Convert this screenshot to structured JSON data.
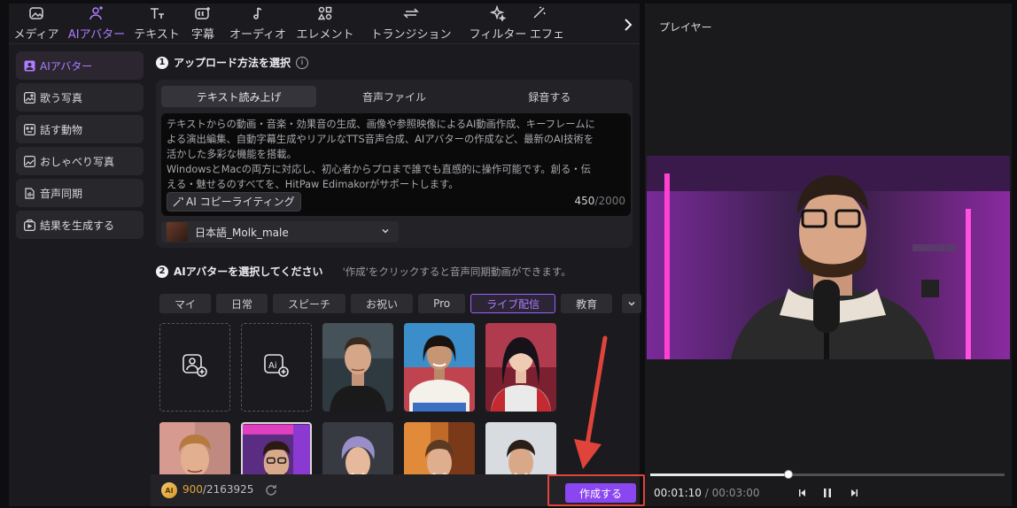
{
  "toolbar": {
    "items": [
      {
        "label": "メディア",
        "icon": "media-icon"
      },
      {
        "label": "AIアバター",
        "icon": "ai-avatar-icon",
        "active": true
      },
      {
        "label": "テキスト",
        "icon": "text-icon"
      },
      {
        "label": "字幕",
        "icon": "subtitle-icon"
      },
      {
        "label": "オーディオ",
        "icon": "audio-icon"
      },
      {
        "label": "エレメント",
        "icon": "element-icon"
      },
      {
        "label": "トランジション",
        "icon": "transition-icon"
      },
      {
        "label": "フィルター",
        "icon": "filter-icon"
      },
      {
        "label": "エフェ",
        "icon": "effect-icon"
      }
    ]
  },
  "sidebar": {
    "items": [
      {
        "label": "AIアバター",
        "active": true
      },
      {
        "label": "歌う写真"
      },
      {
        "label": "話す動物"
      },
      {
        "label": "おしゃべり写真"
      },
      {
        "label": "音声同期"
      },
      {
        "label": "結果を生成する"
      }
    ]
  },
  "step1": {
    "num": "1",
    "title": "アップロード方法を選択",
    "tabs": [
      "テキスト読み上げ",
      "音声ファイル",
      "録音する"
    ],
    "text_lines": [
      "テキストからの動画・音楽・効果音の生成、画像や参照映像によるAI動画作成、キーフレームに",
      "よる演出編集、自動字幕生成やリアルなTTS音声合成、AIアバターの作成など、最新のAI技術を",
      "活かした多彩な機能を搭載。",
      "WindowsとMacの両方に対応し、初心者からプロまで誰でも直感的に操作可能です。創る・伝",
      "える・魅せるのすべてを、HitPaw Edimakorがサポートします。"
    ],
    "copy_button": "AI コピーライティング",
    "char_count": "450",
    "char_max": "/2000",
    "voice": "日本語_Molk_male"
  },
  "step2": {
    "num": "2",
    "title": "AIアバターを選択してください",
    "hint": "'作成'をクリックすると音声同期動画ができます。",
    "categories": [
      "マイ",
      "日常",
      "スピーチ",
      "お祝い",
      "Pro",
      "ライブ配信",
      "教育"
    ],
    "active_category": "ライブ配信"
  },
  "footer": {
    "credits_used": "900",
    "credits_total": "/2163925",
    "create_label": "作成する"
  },
  "player": {
    "title": "プレイヤー",
    "current_time": "00:01:10",
    "separator": " / ",
    "total_time": "00:03:00",
    "progress": 0.39
  },
  "colors": {
    "accent": "#b07cff",
    "create_button": "#8a46f0",
    "highlight_box": "#e0433a"
  }
}
